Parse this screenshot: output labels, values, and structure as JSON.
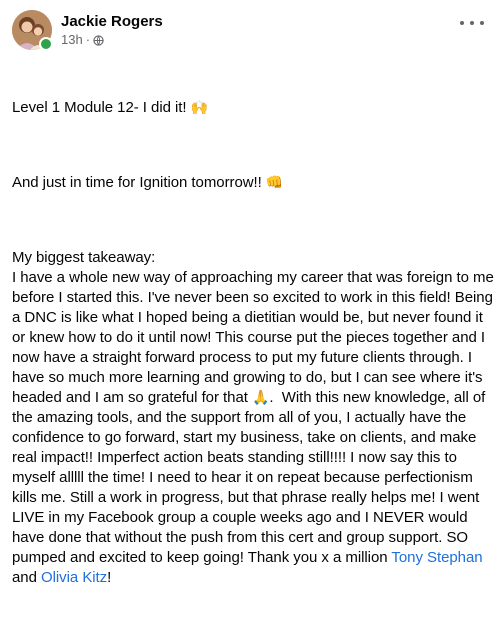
{
  "post": {
    "author": "Jackie Rogers",
    "time": "13h",
    "separator": "·",
    "privacy_icon": "globe-icon",
    "more_icon": "more-options-icon",
    "line1": "Level 1 Module 12- I did it! ",
    "line1_emoji": "🙌",
    "line2": "And just in time for Ignition tomorrow!! ",
    "line2_emoji": "👊",
    "body_part1": "My biggest takeaway:\nI have a whole new way of approaching my career that was foreign to me before I started this. I've never been so excited to work in this field! Being a DNC is like what I hoped being a dietitian would be, but never found it or knew how to do it until now! This course put the pieces together and I now have a straight forward process to put my future clients through. I have so much more learning and growing to do, but I can see where it's headed and I am so grateful for that ",
    "body_emoji": "🙏",
    "body_part2": ".  With this new knowledge, all of the amazing tools, and the support from all of you, I actually have the confidence to go forward, start my business, take on clients, and make real impact!! Imperfect action beats standing still!!!! I now say this to myself alllll the time! I need to hear it on repeat because perfectionism kills me. Still a work in progress, but that phrase really helps me! I went LIVE in my Facebook group a couple weeks ago and I NEVER would have done that without the push from this cert and group support. SO pumped and excited to keep going! Thank you x a million ",
    "mention1": "Tony Stephan",
    "and_text": " and ",
    "mention2": "Olivia Kitz",
    "end_text": "!"
  },
  "colors": {
    "text": "#050505",
    "secondary": "#65676b",
    "link": "#216fdb",
    "online": "#31a24c"
  }
}
